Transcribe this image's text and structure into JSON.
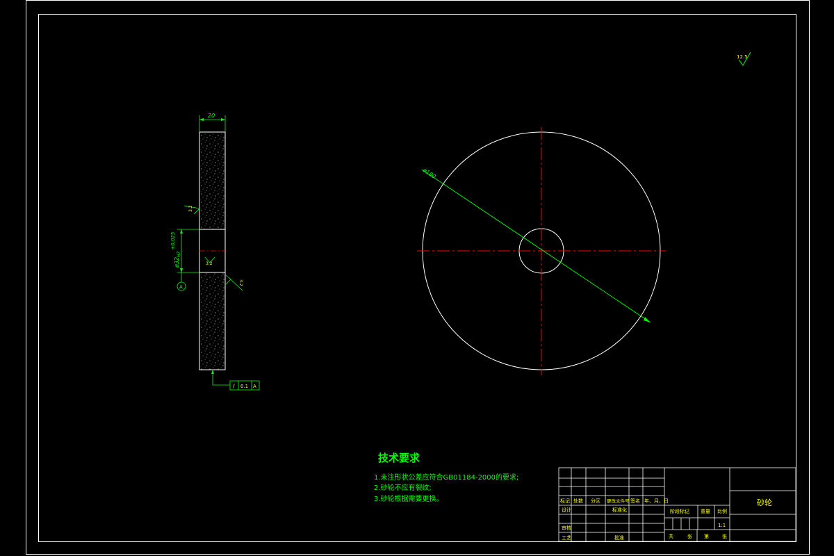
{
  "drawing": {
    "surface_roughness_general": "12.5",
    "side_view": {
      "width_dim": "20",
      "bore_dim_main": "ø32",
      "bore_dim_tol": "H7",
      "bore_dim_dev": "+0.025",
      "rough_top": "3.2",
      "rough_mid": "3.2",
      "rough_right": "3.2",
      "datum_label": "A",
      "fcf": {
        "symbol": "/",
        "value": "0.1",
        "datum": "A"
      }
    },
    "front_view": {
      "diameter_dim": "ø180"
    },
    "tech_req": {
      "title": "技术要求",
      "items": [
        "1.未注形状公差应符合GB01184-2000的要求;",
        "2.砂轮不应有裂纹;",
        "3.砂轮根据需要更换。"
      ]
    },
    "title_block": {
      "part_name": "砂轮",
      "scale": "1:1",
      "hdr": [
        "标记",
        "处数",
        "分区",
        "更改文件号",
        "签名",
        "年、月、日"
      ],
      "design": "设计",
      "standard": "标准化",
      "check": "审核",
      "process": "工艺",
      "approve": "批准",
      "stage_mark": "阶段标记",
      "weight": "重量",
      "ratio": "比例",
      "sheets_total": "共",
      "sheets_unit": "张",
      "sheet_no": "第",
      "sheet_unit2": "张"
    },
    "colors": {
      "background": "#000000",
      "outline": "#ffffff",
      "dimension": "#00ff00",
      "centerline": "#ff0000",
      "annotation": "#ffff00"
    }
  }
}
